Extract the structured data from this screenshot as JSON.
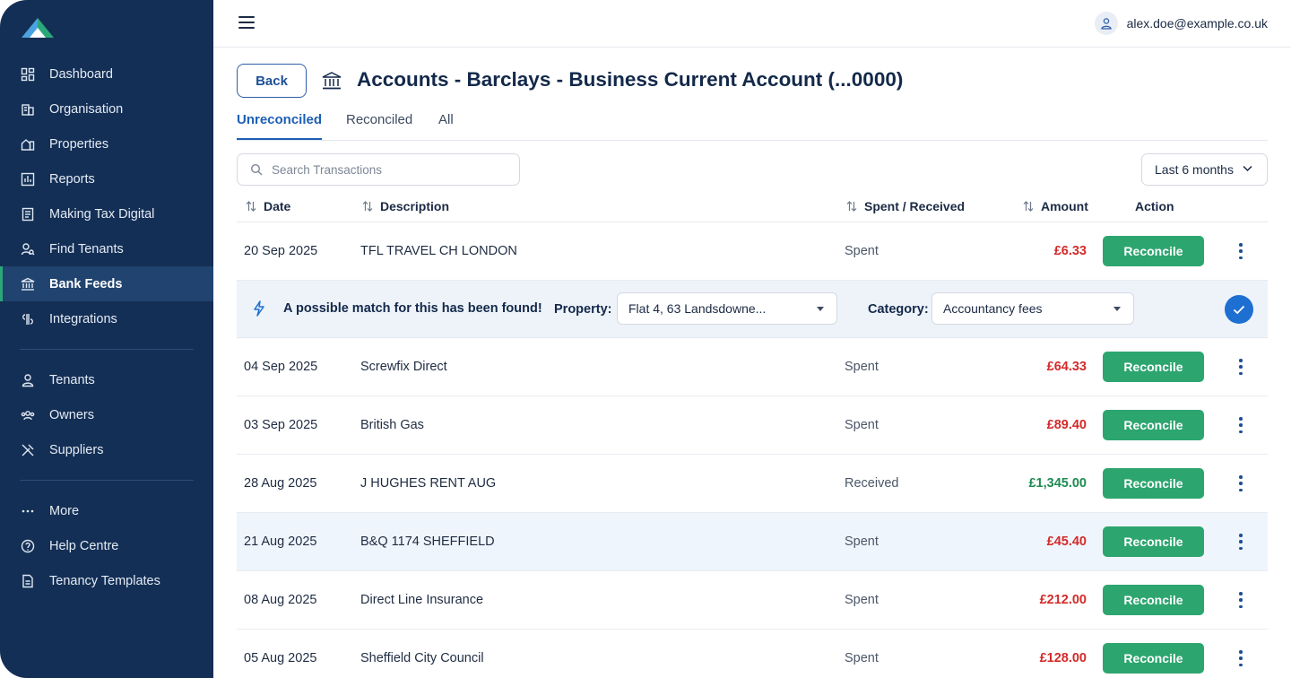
{
  "sidebar": {
    "primary": [
      {
        "label": "Dashboard",
        "icon": "dashboard-icon"
      },
      {
        "label": "Organisation",
        "icon": "building-icon"
      },
      {
        "label": "Properties",
        "icon": "properties-icon"
      },
      {
        "label": "Reports",
        "icon": "reports-icon"
      },
      {
        "label": "Making Tax Digital",
        "icon": "tax-icon"
      },
      {
        "label": "Find Tenants",
        "icon": "find-tenants-icon"
      },
      {
        "label": "Bank Feeds",
        "icon": "bank-icon",
        "active": true
      },
      {
        "label": "Integrations",
        "icon": "integrations-icon"
      }
    ],
    "secondary": [
      {
        "label": "Tenants",
        "icon": "person-icon"
      },
      {
        "label": "Owners",
        "icon": "group-icon"
      },
      {
        "label": "Suppliers",
        "icon": "tools-icon"
      }
    ],
    "tertiary": [
      {
        "label": "More",
        "icon": "more-icon"
      },
      {
        "label": "Help Centre",
        "icon": "help-icon"
      },
      {
        "label": "Tenancy Templates",
        "icon": "document-icon"
      }
    ]
  },
  "topbar": {
    "user_email": "alex.doe@example.co.uk"
  },
  "page": {
    "back_label": "Back",
    "title": "Accounts - Barclays - Business Current Account (...0000)",
    "tabs": [
      {
        "label": "Unreconciled",
        "active": true
      },
      {
        "label": "Reconciled"
      },
      {
        "label": "All"
      }
    ],
    "search_placeholder": "Search Transactions",
    "period": "Last 6 months"
  },
  "table": {
    "headers": {
      "date": "Date",
      "description": "Description",
      "type": "Spent / Received",
      "amount": "Amount",
      "action": "Action"
    },
    "reconcile_label": "Reconcile",
    "rows": [
      {
        "date": "20 Sep 2025",
        "description": "TFL TRAVEL CH LONDON",
        "type": "Spent",
        "amount": "£6.33",
        "direction": "spent"
      },
      {
        "date": "04 Sep 2025",
        "description": "Screwfix Direct",
        "type": "Spent",
        "amount": "£64.33",
        "direction": "spent"
      },
      {
        "date": "03 Sep 2025",
        "description": "British Gas",
        "type": "Spent",
        "amount": "£89.40",
        "direction": "spent"
      },
      {
        "date": "28 Aug 2025",
        "description": "J HUGHES RENT AUG",
        "type": "Received",
        "amount": "£1,345.00",
        "direction": "received"
      },
      {
        "date": "21 Aug 2025",
        "description": "B&Q 1174 SHEFFIELD",
        "type": "Spent",
        "amount": "£45.40",
        "direction": "spent",
        "highlighted": true
      },
      {
        "date": "08 Aug 2025",
        "description": "Direct Line Insurance",
        "type": "Spent",
        "amount": "£212.00",
        "direction": "spent"
      },
      {
        "date": "05 Aug 2025",
        "description": "Sheffield City Council",
        "type": "Spent",
        "amount": "£128.00",
        "direction": "spent"
      }
    ]
  },
  "match": {
    "message": "A possible match for this has been found!",
    "property_label": "Property:",
    "property_value": "Flat 4, 63 Landsdowne...",
    "category_label": "Category:",
    "category_value": "Accountancy fees"
  },
  "colors": {
    "sidebar_bg": "#142f55",
    "accent_blue": "#1d5fb5",
    "reconcile_green": "#2da56f",
    "spent_red": "#d42a2a",
    "received_green": "#1f8a52"
  }
}
